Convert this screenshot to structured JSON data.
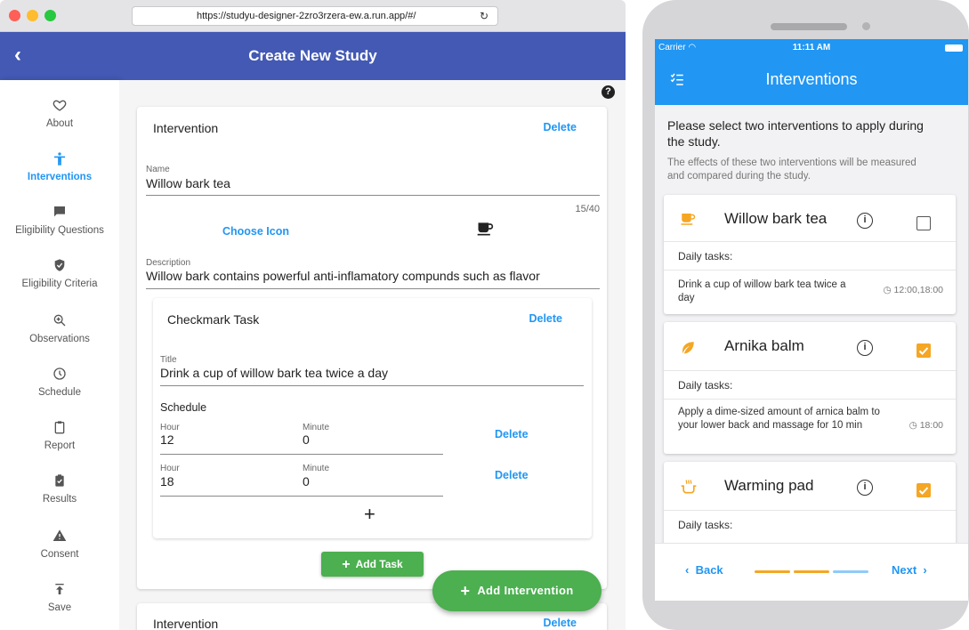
{
  "browser": {
    "url": "https://studyu-designer-2zro3rzera-ew.a.run.app/#/",
    "traffic_colors": [
      "#fe5f57",
      "#febc2e",
      "#28c840"
    ]
  },
  "designer": {
    "title": "Create New Study",
    "sidebar": [
      {
        "label": "About",
        "icon": "heart-icon"
      },
      {
        "label": "Interventions",
        "icon": "accessibility-icon",
        "active": true
      },
      {
        "label": "Eligibility Questions",
        "icon": "chat-icon"
      },
      {
        "label": "Eligibility Criteria",
        "icon": "shield-check-icon"
      },
      {
        "label": "Observations",
        "icon": "zoom-in-icon"
      },
      {
        "label": "Schedule",
        "icon": "clock-icon"
      },
      {
        "label": "Report",
        "icon": "clipboard-icon"
      },
      {
        "label": "Results",
        "icon": "clipboard-check-icon"
      },
      {
        "label": "Consent",
        "icon": "warning-icon"
      },
      {
        "label": "Save",
        "icon": "publish-icon"
      }
    ],
    "intervention_card": {
      "title": "Intervention",
      "delete_label": "Delete",
      "name_label": "Name",
      "name_value": "Willow bark tea",
      "char_counter": "15/40",
      "choose_icon_label": "Choose Icon",
      "description_label": "Description",
      "description_value": "Willow bark contains powerful anti-inflamatory compunds such as flavor",
      "task": {
        "title": "Checkmark Task",
        "delete_label": "Delete",
        "title_label": "Title",
        "title_value": "Drink a cup of willow bark tea twice a day",
        "schedule_label": "Schedule",
        "rows": [
          {
            "hour_label": "Hour",
            "hour": "12",
            "minute_label": "Minute",
            "minute": "0",
            "delete": "Delete"
          },
          {
            "hour_label": "Hour",
            "hour": "18",
            "minute_label": "Minute",
            "minute": "0",
            "delete": "Delete"
          }
        ],
        "add_symbol": "+"
      },
      "add_task_label": "Add Task"
    },
    "second_card": {
      "title": "Intervention",
      "delete_label": "Delete"
    },
    "fab_label": "Add Intervention",
    "help_symbol": "?"
  },
  "phone": {
    "carrier": "Carrier",
    "time": "11:11 AM",
    "title": "Interventions",
    "intro": "Please select two interventions to apply during the study.",
    "sub": "The effects of these two interventions will be measured and compared during the study.",
    "interventions": [
      {
        "name": "Willow bark tea",
        "icon": "coffee-cup-icon",
        "checked": false,
        "daily_label": "Daily tasks:",
        "task": "Drink a cup of willow bark tea twice a day",
        "time": "12:00,18:00"
      },
      {
        "name": "Arnika balm",
        "icon": "leaf-icon",
        "checked": true,
        "daily_label": "Daily tasks:",
        "task": "Apply a dime-sized amount of arnica balm to your lower back and massage for 10 min",
        "time": "18:00"
      },
      {
        "name": "Warming pad",
        "icon": "hot-tub-icon",
        "checked": true,
        "daily_label": "Daily tasks:"
      }
    ],
    "back_label": "Back",
    "next_label": "Next",
    "progress_colors": [
      "#f5a623",
      "#f5a623",
      "#90caf9"
    ],
    "accent": "#2196f3",
    "check_color": "#f5a623"
  }
}
